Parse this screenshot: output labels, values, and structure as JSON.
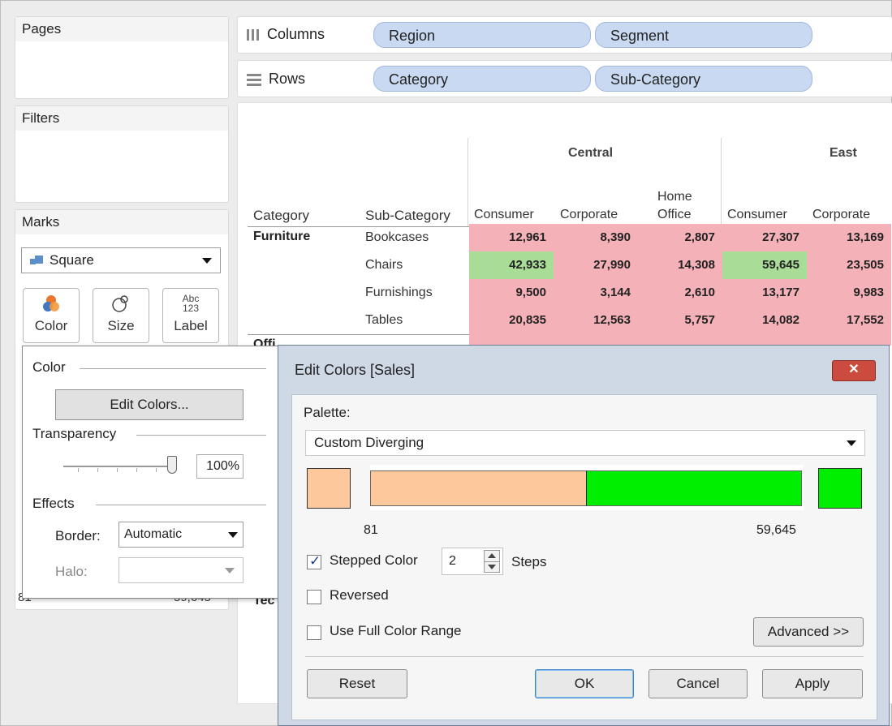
{
  "panels": {
    "pages": "Pages",
    "filters": "Filters",
    "marks": {
      "title": "Marks",
      "mark_type": "Square",
      "buttons": [
        {
          "label": "Color",
          "icon": "color-icon"
        },
        {
          "label": "Size",
          "icon": "size-icon"
        },
        {
          "label": "Label",
          "icon": "label-icon",
          "icon_text_top": "Abc",
          "icon_text_bottom": "123"
        }
      ]
    }
  },
  "shelves": {
    "columns": {
      "label": "Columns",
      "pills": [
        "Region",
        "Segment"
      ]
    },
    "rows": {
      "label": "Rows",
      "pills": [
        "Category",
        "Sub-Category"
      ]
    }
  },
  "table": {
    "headers": {
      "category": "Category",
      "sub_category": "Sub-Category"
    },
    "regions": [
      "Central",
      "East"
    ],
    "segments": {
      "central": [
        "Consumer",
        "Corporate",
        "Home",
        "Office"
      ],
      "east": [
        "Consumer",
        "Corporate"
      ]
    },
    "category": "Furniture",
    "sub_categories": [
      "Bookcases",
      "Chairs",
      "Furnishings",
      "Tables"
    ],
    "rows": [
      [
        "12,961",
        "8,390",
        "2,807",
        "27,307",
        "13,169"
      ],
      [
        "42,933",
        "27,990",
        "14,308",
        "59,645",
        "23,505"
      ],
      [
        "9,500",
        "3,144",
        "2,610",
        "13,177",
        "9,983"
      ],
      [
        "20,835",
        "12,563",
        "5,757",
        "14,082",
        "17,552"
      ]
    ],
    "partial_labels": {
      "office": "Offi",
      "technology": "Tec"
    }
  },
  "color_popup": {
    "color_title": "Color",
    "edit_colors": "Edit Colors...",
    "transparency_title": "Transparency",
    "transparency_value": "100%",
    "effects_title": "Effects",
    "border_label": "Border:",
    "border_value": "Automatic",
    "halo_label": "Halo:",
    "behind_left": "81",
    "behind_right": "59,645"
  },
  "dialog": {
    "title": "Edit Colors [Sales]",
    "close": "✕",
    "palette_label": "Palette:",
    "palette_value": "Custom Diverging",
    "min_value": "81",
    "max_value": "59,645",
    "stepped_color_label": "Stepped Color",
    "stepped_color_checked": true,
    "steps_value": "2",
    "steps_label": "Steps",
    "reversed_label": "Reversed",
    "full_range_label": "Use Full Color Range",
    "advanced": "Advanced >>",
    "reset": "Reset",
    "ok": "OK",
    "cancel": "Cancel",
    "apply": "Apply",
    "colors": {
      "start": "#fdc89b",
      "end": "#00ee00"
    }
  }
}
